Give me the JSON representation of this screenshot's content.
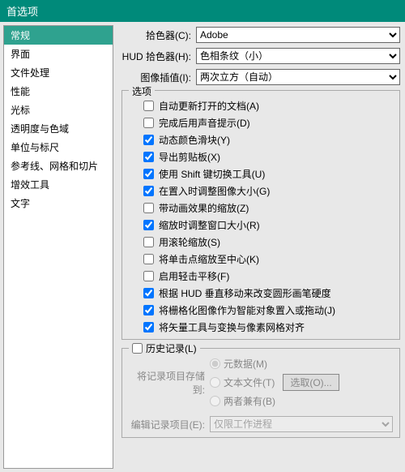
{
  "window": {
    "title": "首选项"
  },
  "sidebar": {
    "items": [
      "常规",
      "界面",
      "文件处理",
      "性能",
      "光标",
      "透明度与色域",
      "单位与标尺",
      "参考线、网格和切片",
      "增效工具",
      "文字"
    ]
  },
  "pickers": {
    "colorPicker": {
      "label": "拾色器(C):",
      "value": "Adobe"
    },
    "hudPicker": {
      "label": "HUD 拾色器(H):",
      "value": "色相条纹（小）"
    },
    "interpolation": {
      "label": "图像插值(I):",
      "value": "两次立方（自动）"
    }
  },
  "options": {
    "legend": "选项",
    "items": [
      {
        "label": "自动更新打开的文档(A)",
        "checked": false
      },
      {
        "label": "完成后用声音提示(D)",
        "checked": false
      },
      {
        "label": "动态颜色滑块(Y)",
        "checked": true
      },
      {
        "label": "导出剪贴板(X)",
        "checked": true
      },
      {
        "label": "使用 Shift 键切换工具(U)",
        "checked": true
      },
      {
        "label": "在置入时调整图像大小(G)",
        "checked": true
      },
      {
        "label": "带动画效果的缩放(Z)",
        "checked": false
      },
      {
        "label": "缩放时调整窗口大小(R)",
        "checked": true
      },
      {
        "label": "用滚轮缩放(S)",
        "checked": false
      },
      {
        "label": "将单击点缩放至中心(K)",
        "checked": false
      },
      {
        "label": "启用轻击平移(F)",
        "checked": false
      },
      {
        "label": "根据 HUD 垂直移动来改变圆形画笔硬度",
        "checked": true
      },
      {
        "label": "将栅格化图像作为智能对象置入或拖动(J)",
        "checked": true
      },
      {
        "label": "将矢量工具与变换与像素网格对齐",
        "checked": true
      }
    ]
  },
  "history": {
    "legend": "历史记录(L)",
    "saveTo": {
      "label": "将记录项目存储到:",
      "options": [
        "元数据(M)",
        "文本文件(T)",
        "两者兼有(B)"
      ],
      "chooseBtn": "选取(O)..."
    },
    "editLog": {
      "label": "编辑记录项目(E):",
      "value": "仅限工作进程"
    }
  }
}
